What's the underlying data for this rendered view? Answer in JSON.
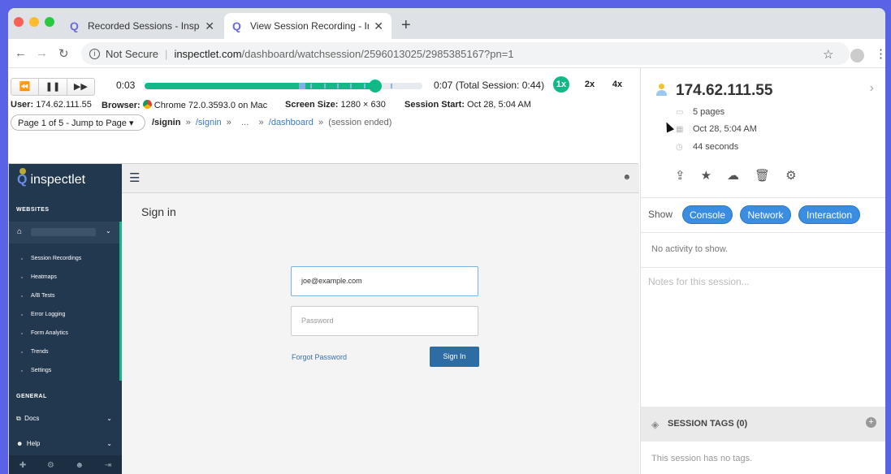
{
  "browser": {
    "tabs": [
      {
        "title": "Recorded Sessions - Inspectle",
        "active": false
      },
      {
        "title": "View Session Recording - Insp",
        "active": true
      }
    ],
    "new_tab": "+",
    "not_secure": "Not Secure",
    "url_host": "inspectlet.com",
    "url_path": "/dashboard/watchsession/2596013025/2985385167?pn=1"
  },
  "player": {
    "buttons": [
      "⏪",
      "❚❚",
      "▶▶"
    ],
    "current_time": "0:03",
    "end_time": "0:07 (Total Session: 0:44)",
    "progress": 0.83,
    "speeds": [
      {
        "label": "1x",
        "active": true
      },
      {
        "label": "2x",
        "active": false
      },
      {
        "label": "4x",
        "active": false
      }
    ],
    "info": {
      "user_label": "User:",
      "user": "174.62.111.55",
      "browser_label": "Browser:",
      "browser": "Chrome 72.0.3593.0 on Mac",
      "screen_label": "Screen Size:",
      "screen": "1280 × 630",
      "start_label": "Session Start:",
      "start": "Oct 28, 5:04 AM"
    },
    "page_select": "Page 1 of 5 - Jump to Page ▾",
    "crumbs": {
      "current": "/signin",
      "link1": "/signin",
      "ellipsis": "...",
      "link2": "/dashboard",
      "ended": "(session ended)",
      "sep": "»"
    }
  },
  "app": {
    "brand": "inspectlet",
    "websites_header": "WEBSITES",
    "nav_items": [
      "Session Recordings",
      "Heatmaps",
      "A/B Tests",
      "Error Logging",
      "Form Analytics",
      "Trends",
      "Settings"
    ],
    "general_header": "GENERAL",
    "general_items": [
      "Docs",
      "Help"
    ],
    "page_title": "Sign in",
    "email_value": "joe@example.com",
    "password_placeholder": "Password",
    "forgot_password": "Forgot Password",
    "sign_in_button": "Sign In"
  },
  "panel": {
    "ip": "174.62.111.55",
    "pages": "5 pages",
    "date": "Oct 28, 5:04 AM",
    "duration": "44 seconds",
    "show_label": "Show",
    "filters": [
      "Console",
      "Network",
      "Interaction"
    ],
    "no_activity": "No activity to show.",
    "notes_placeholder": "Notes for this session...",
    "tags_title": "SESSION TAGS (0)",
    "no_tags": "This session has no tags."
  },
  "colors": {
    "accent_green": "#12b886",
    "pill_blue": "#3a8de0",
    "sidebar_navy": "#22384f",
    "signin_button": "#2e6ca4",
    "frame_purple": "#5a63e6"
  }
}
